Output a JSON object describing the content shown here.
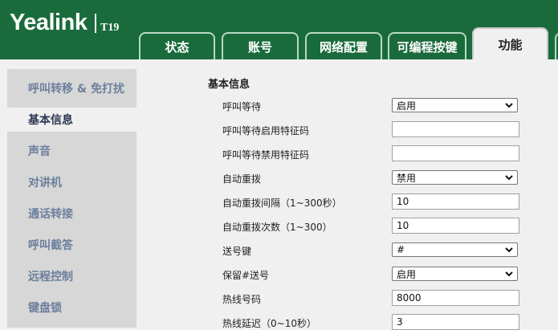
{
  "header": {
    "logo": "Yealink",
    "model": "T19",
    "tabs": [
      "状态",
      "账号",
      "网络配置",
      "可编程按键",
      "功能"
    ]
  },
  "sidebar": {
    "items": [
      "呼叫转移 & 免打扰",
      "基本信息",
      "声音",
      "对讲机",
      "通话转接",
      "呼叫截答",
      "远程控制",
      "键盘锁"
    ]
  },
  "main": {
    "section_title": "基本信息",
    "rows": [
      {
        "label": "呼叫等待",
        "type": "select",
        "value": "启用"
      },
      {
        "label": "呼叫等待启用特征码",
        "type": "input",
        "value": ""
      },
      {
        "label": "呼叫等待禁用特征码",
        "type": "input",
        "value": ""
      },
      {
        "label": "自动重拨",
        "type": "select",
        "value": "禁用"
      },
      {
        "label": "自动重拨间隔（1~300秒）",
        "type": "input",
        "value": "10"
      },
      {
        "label": "自动重拨次数（1~300）",
        "type": "input",
        "value": "10"
      },
      {
        "label": "送号键",
        "type": "select",
        "value": "#"
      },
      {
        "label": "保留#送号",
        "type": "select",
        "value": "启用"
      },
      {
        "label": "热线号码",
        "type": "input",
        "value": "8000"
      },
      {
        "label": "热线延迟（0~10秒）",
        "type": "input",
        "value": "3"
      }
    ]
  },
  "colors": {
    "header_bg": "#1a6b3c",
    "sidebar_bg": "#d7d7d7",
    "sidebar_text": "#6c7f9c"
  }
}
